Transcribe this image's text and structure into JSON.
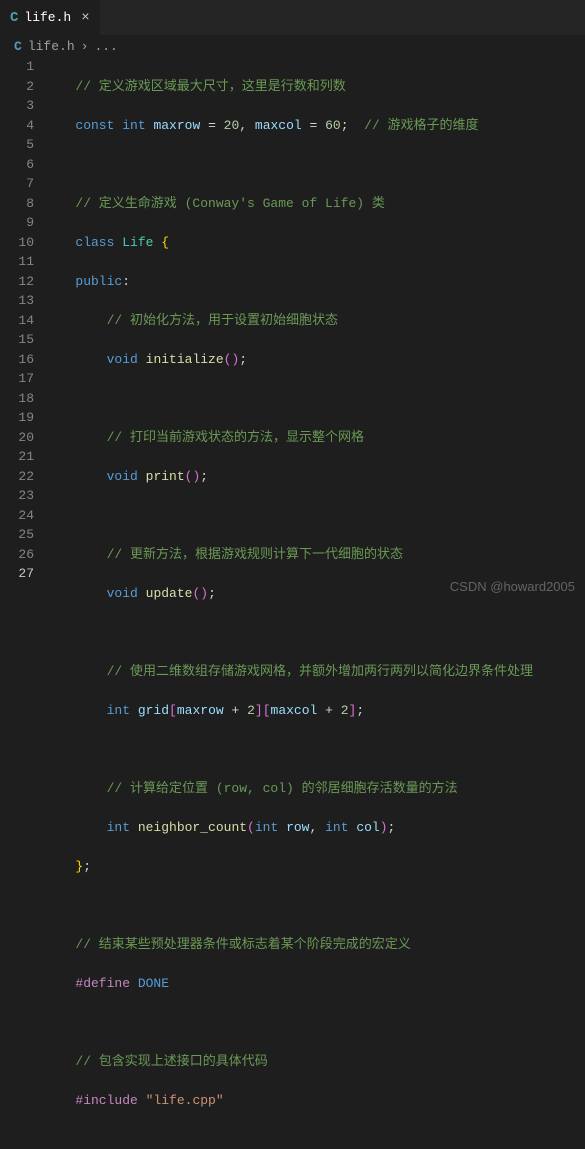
{
  "tab": {
    "icon_letter": "C",
    "filename": "life.h"
  },
  "breadcrumb": {
    "icon_letter": "C",
    "filename": "life.h",
    "chevron": "›",
    "after": "..."
  },
  "gutter": {
    "start": 1,
    "end": 27,
    "active": 27
  },
  "code": {
    "l1_comment": "// 定义游戏区域最大尺寸，这里是行数和列数",
    "l2_const": "const",
    "l2_int": "int",
    "l2_maxrow": "maxrow",
    "l2_eq1": " = ",
    "l2_20": "20",
    "l2_comma": ", ",
    "l2_maxcol": "maxcol",
    "l2_eq2": " = ",
    "l2_60": "60",
    "l2_semi": "; ",
    "l2_comment": "// 游戏格子的维度",
    "l4_comment": "// 定义生命游戏 (Conway's Game of Life) 类",
    "l5_class": "class",
    "l5_name": "Life",
    "l5_brace": " {",
    "l6_public": "public",
    "l6_colon": ":",
    "l7_comment": "// 初始化方法，用于设置初始细胞状态",
    "l8_void": "void",
    "l8_func": "initialize",
    "l8_paren": "()",
    "l8_semi": ";",
    "l10_comment": "// 打印当前游戏状态的方法，显示整个网格",
    "l11_void": "void",
    "l11_func": "print",
    "l11_paren": "()",
    "l11_semi": ";",
    "l13_comment": "// 更新方法，根据游戏规则计算下一代细胞的状态",
    "l14_void": "void",
    "l14_func": "update",
    "l14_paren": "()",
    "l14_semi": ";",
    "l16_comment": "// 使用二维数组存储游戏网格，并额外增加两行两列以简化边界条件处理",
    "l17_int": "int",
    "l17_grid": "grid",
    "l17_b1o": "[",
    "l17_maxrow": "maxrow",
    "l17_plus1": " + ",
    "l17_2a": "2",
    "l17_b1c": "]",
    "l17_b2o": "[",
    "l17_maxcol": "maxcol",
    "l17_plus2": " + ",
    "l17_2b": "2",
    "l17_b2c": "]",
    "l17_semi": ";",
    "l19_comment": "// 计算给定位置 (row, col) 的邻居细胞存活数量的方法",
    "l20_int": "int",
    "l20_func": "neighbor_count",
    "l20_po": "(",
    "l20_t1": "int",
    "l20_p1": "row",
    "l20_comma": ", ",
    "l20_t2": "int",
    "l20_p2": "col",
    "l20_pc": ")",
    "l20_semi": ";",
    "l21_brace": "}",
    "l21_semi": ";",
    "l23_comment": "// 结束某些预处理器条件或标志着某个阶段完成的宏定义",
    "l24_define": "#define",
    "l24_name": "DONE",
    "l26_comment": "// 包含实现上述接口的具体代码",
    "l27_include": "#include",
    "l27_str": "\"life.cpp\""
  },
  "watermark": "CSDN @howard2005"
}
